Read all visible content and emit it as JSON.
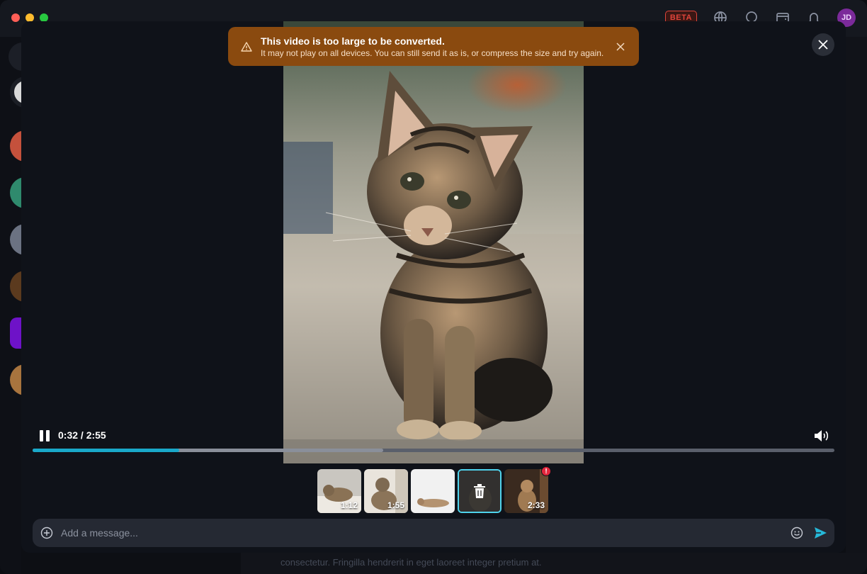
{
  "app": {
    "beta_label": "BETA",
    "user_initials": "JD"
  },
  "background": {
    "composer_text": "consectetur. Fringilla hendrerit in eget laoreet integer pretium at."
  },
  "toast": {
    "title": "This video is too large to be converted.",
    "message": "It may not play on all devices. You can still send it as is, or compress the size and try again.",
    "icon": "warning-icon",
    "color": "#8a4a0f"
  },
  "player": {
    "time": "0:32 / 2:55",
    "progress_fraction": 0.183,
    "buffered_fraction": 0.437,
    "accent_color": "#19a8c9"
  },
  "thumbnails": [
    {
      "duration": "1:12",
      "selected": false,
      "error": false
    },
    {
      "duration": "1:55",
      "selected": false,
      "error": false
    },
    {
      "duration": "",
      "selected": false,
      "error": false
    },
    {
      "duration": "",
      "selected": true,
      "error": false
    },
    {
      "duration": "2:33",
      "selected": false,
      "error": true,
      "badge": "!"
    }
  ],
  "composer": {
    "placeholder": "Add a message..."
  }
}
